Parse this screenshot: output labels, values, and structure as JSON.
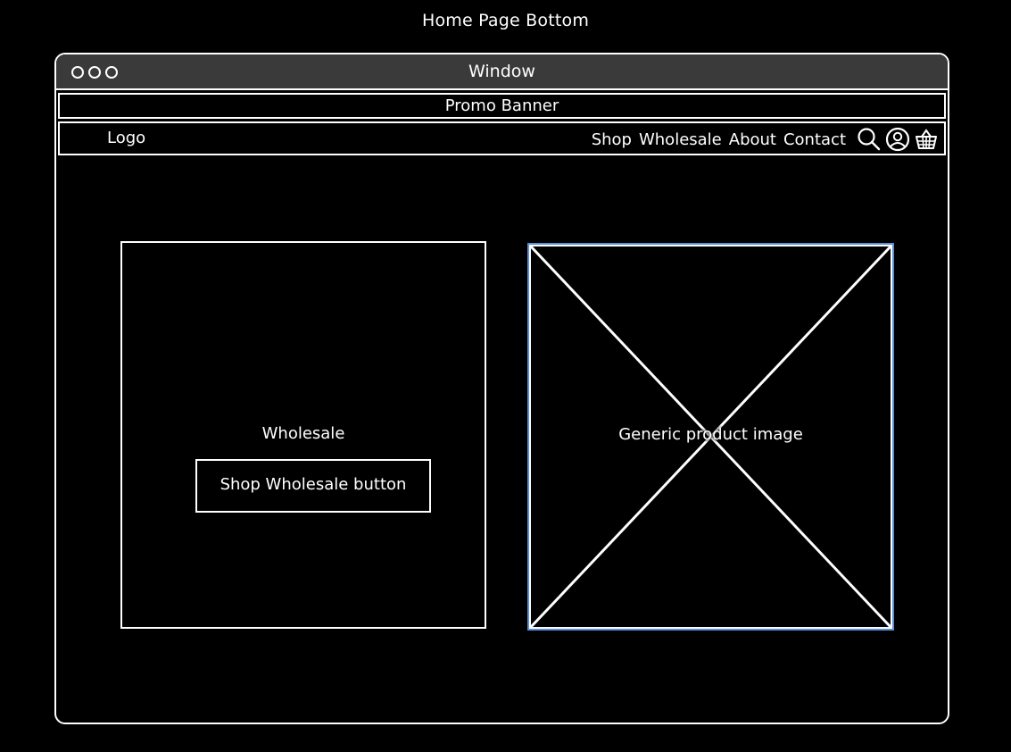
{
  "page": {
    "title": "Home Page Bottom"
  },
  "window": {
    "title": "Window"
  },
  "promo_banner": {
    "label": "Promo Banner"
  },
  "nav": {
    "logo": "Logo",
    "links": [
      "Shop",
      "Wholesale",
      "About",
      "Contact"
    ],
    "icons": [
      "search-icon",
      "account-icon",
      "basket-icon"
    ]
  },
  "wholesale": {
    "title": "Wholesale",
    "button_label": "Shop Wholesale button"
  },
  "product_image": {
    "label": "Generic product image"
  },
  "colors": {
    "background": "#000000",
    "foreground": "#ffffff",
    "titlebar": "#3a3a3a",
    "selection": "#5b8fd6"
  }
}
